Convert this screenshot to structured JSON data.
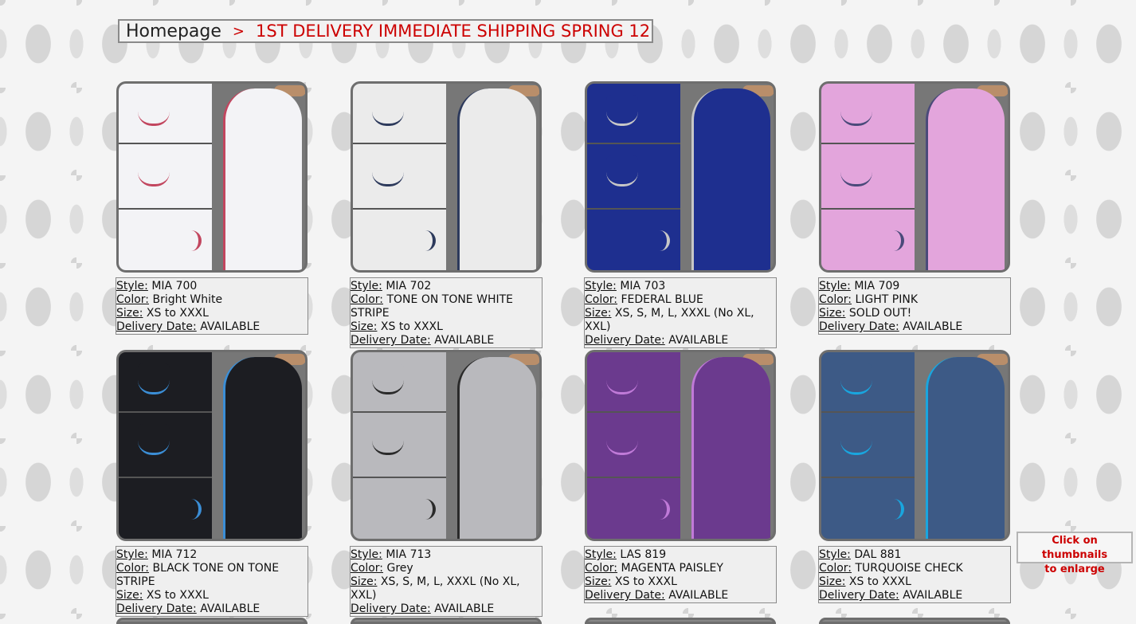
{
  "breadcrumb": {
    "home": "Homepage",
    "separator": ">",
    "current": "1ST DELIVERY IMMEDIATE SHIPPING SPRING 12"
  },
  "labels": {
    "style": "Style:",
    "color": "Color:",
    "size": "Size:",
    "delivery": "Delivery Date:"
  },
  "hint": {
    "line1": "Click on thumbnails",
    "line2": "to enlarge"
  },
  "products": [
    {
      "style": "MIA 700",
      "color": "Bright White",
      "size": "XS to XXXL",
      "delivery": "AVAILABLE",
      "swatch": "#f3f3f6",
      "accent": "#c2465f"
    },
    {
      "style": "MIA 702",
      "color": "TONE ON TONE WHITE STRIPE",
      "size": "XS to XXXL",
      "delivery": "AVAILABLE",
      "swatch": "#ebebeb",
      "accent": "#2d3a5c"
    },
    {
      "style": "MIA 703",
      "color": "FEDERAL BLUE",
      "size": "XS, S, M, L, XXXL (No XL, XXL)",
      "delivery": "AVAILABLE",
      "swatch": "#1e2f8f",
      "accent": "#c7c7c7"
    },
    {
      "style": "MIA 709",
      "color": "LIGHT PINK",
      "size": "SOLD OUT!",
      "delivery": "AVAILABLE",
      "swatch": "#e3a5dc",
      "accent": "#4a4a7a"
    },
    {
      "style": "MIA 712",
      "color": "BLACK TONE ON TONE STRIPE",
      "size": "XS to XXXL",
      "delivery": "AVAILABLE",
      "swatch": "#1c1d22",
      "accent": "#3b8ed6"
    },
    {
      "style": "MIA 713",
      "color": "Grey",
      "size": "XS, S, M, L, XXXL (No XL, XXL)",
      "delivery": "AVAILABLE",
      "swatch": "#b9b9bd",
      "accent": "#2a2a2a"
    },
    {
      "style": "LAS 819",
      "color": "MAGENTA PAISLEY",
      "size": "XS to XXXL",
      "delivery": "AVAILABLE",
      "swatch": "#6b3a8e",
      "accent": "#c07ad8"
    },
    {
      "style": "DAL 881",
      "color": "TURQUOISE CHECK",
      "size": "XS to XXXL",
      "delivery": "AVAILABLE",
      "swatch": "#3d5a86",
      "accent": "#19a6df"
    }
  ]
}
